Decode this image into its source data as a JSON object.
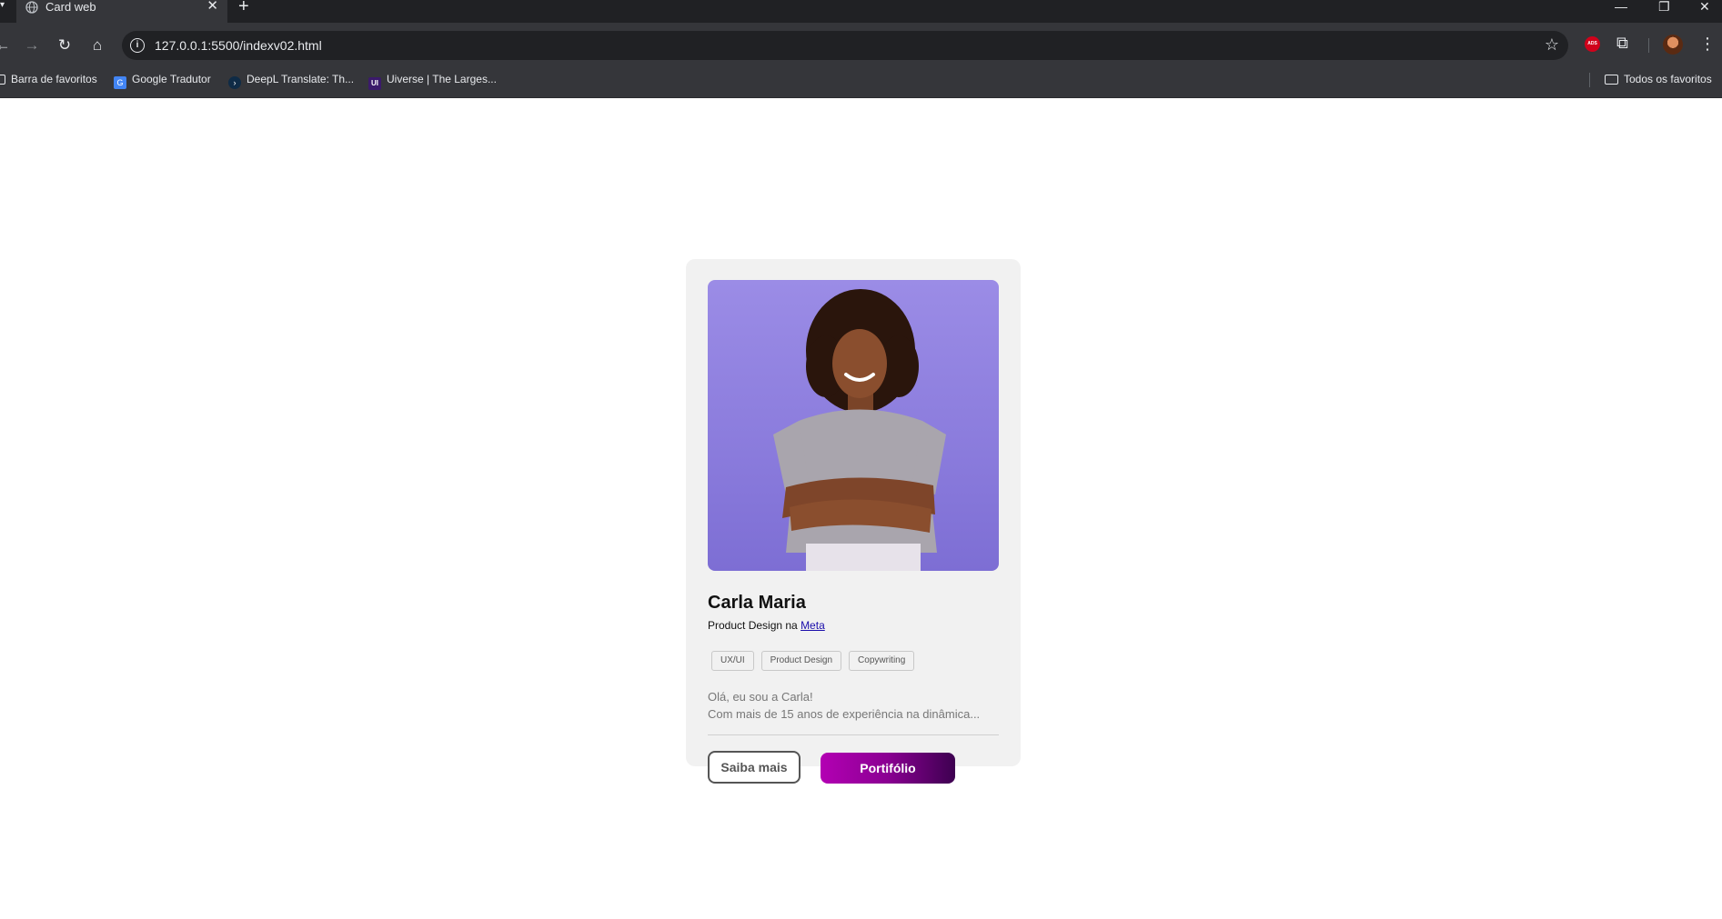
{
  "browser": {
    "tab_title": "Card web",
    "tab_close": "✕",
    "new_tab": "+",
    "url": "127.0.0.1:5500/indexv02.html",
    "ext_label": "ADS",
    "window_controls": [
      "—",
      "❐",
      "✕"
    ]
  },
  "bookmarks": {
    "items": [
      {
        "label": "Barra de favoritos",
        "icon": "folder-icon"
      },
      {
        "label": "Google Tradutor",
        "icon": "google-translate-icon"
      },
      {
        "label": "DeepL Translate: Th...",
        "icon": "deepl-icon"
      },
      {
        "label": "Uiverse | The Larges...",
        "icon": "uiverse-icon"
      }
    ],
    "all_label": "Todos os favoritos"
  },
  "card": {
    "name": "Carla Maria",
    "role_prefix": "Product Design na ",
    "role_link": "Meta",
    "tags": [
      "UX/UI",
      "Product Design",
      "Copywriting"
    ],
    "bio_line1": "Olá, eu sou a Carla!",
    "bio_line2": "Com mais de 15 anos de experiência na dinâmica...",
    "btn_secondary": "Saiba mais",
    "btn_primary": "Portifólio",
    "colors": {
      "photo_bg": "#8a7bdc",
      "primary_gradient_start": "#b300b3",
      "primary_gradient_end": "#3d0050",
      "card_bg": "#f1f1f1"
    }
  }
}
